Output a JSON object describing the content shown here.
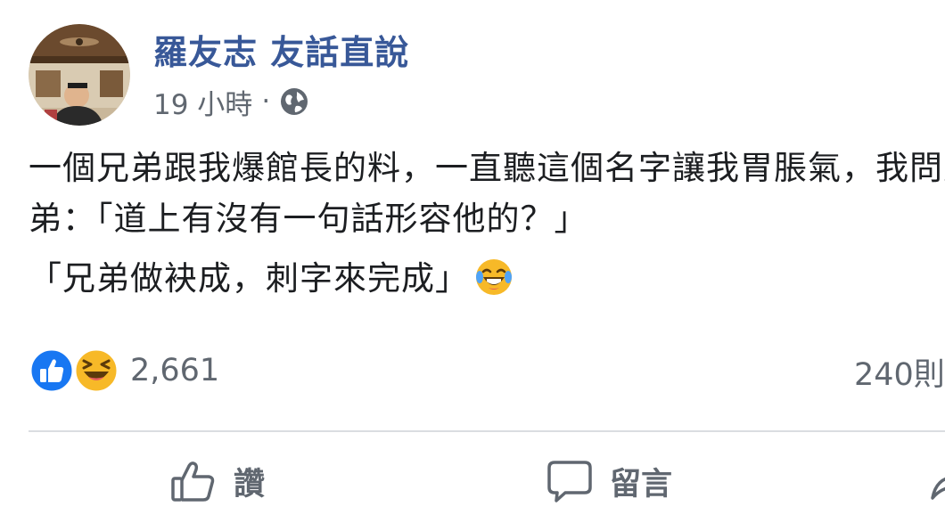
{
  "post": {
    "author": "羅友志 友話直說",
    "time": "19 小時",
    "separator": "·",
    "privacy_icon": "globe-icon",
    "lines": [
      "一個兄弟跟我爆館長的料，一直聽這個名字讓我胃脹氣，我問兄",
      "弟：「道上有沒有一句話形容他的？」",
      "「兄弟做袂成，刺字來完成」"
    ],
    "inline_emoji": "laughing-tears-emoji"
  },
  "reactions": {
    "icons": [
      "like-reaction-icon",
      "haha-reaction-icon"
    ],
    "count": "2,661",
    "comments": "240則"
  },
  "actions": {
    "like_label": "讚",
    "comment_label": "留言",
    "share_label": ""
  },
  "colors": {
    "author": "#385898",
    "meta": "#606770",
    "like_blue": "#1877f2",
    "haha_yellow": "#f7b928",
    "divider": "#dadde1"
  }
}
